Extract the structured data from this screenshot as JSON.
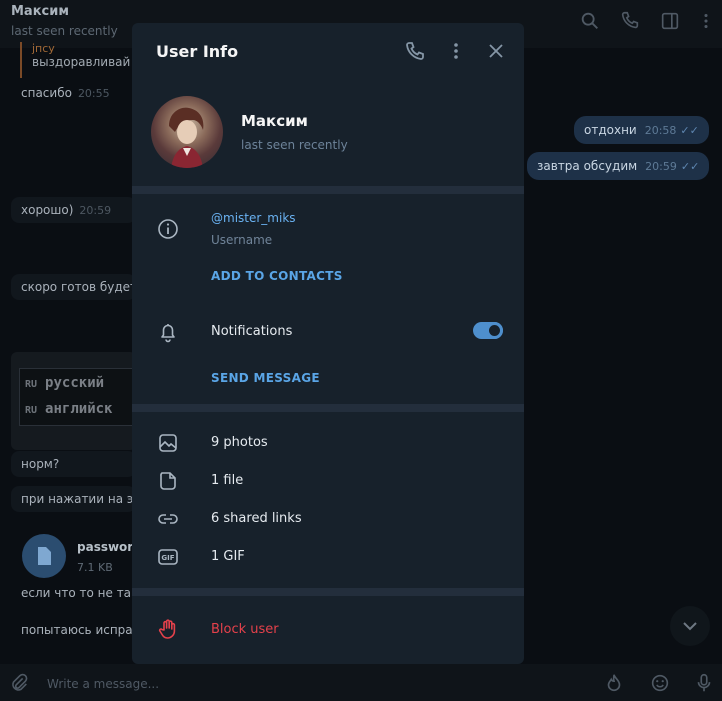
{
  "chat": {
    "title": "Максим",
    "status": "last seen recently",
    "reply": {
      "author": "јпсу",
      "text": "выздоравливай"
    },
    "incoming": [
      {
        "text": "спасибо",
        "time": "20:55"
      },
      {
        "text": "хорошо)",
        "time": "20:59"
      },
      {
        "text": "скоро готов будет",
        "time": ""
      },
      {
        "text": "норм?",
        "time": ""
      },
      {
        "text": "при нажатии на эт",
        "time": ""
      },
      {
        "text": "если что то не так",
        "time": ""
      },
      {
        "text": "попытаюсь испра",
        "time": ""
      }
    ],
    "outgoing": [
      {
        "text": "отдохни",
        "time": "20:58",
        "tick": "✓✓"
      },
      {
        "text": "завтра обсудим",
        "time": "20:59",
        "tick": "✓✓"
      }
    ],
    "lang_rows": [
      {
        "code": "RU",
        "name": "русский"
      },
      {
        "code": "RU",
        "name": "английск"
      }
    ],
    "file": {
      "name": "passwor",
      "size": "7.1 KB"
    },
    "composer_placeholder": "Write a message..."
  },
  "modal": {
    "title": "User Info",
    "user": {
      "name": "Максим",
      "status": "last seen recently"
    },
    "username": "@mister_miks",
    "username_label": "Username",
    "add_contacts": "ADD TO CONTACTS",
    "notifications_label": "Notifications",
    "notifications_on": true,
    "send_message": "SEND MESSAGE",
    "media": [
      {
        "icon": "photo-icon",
        "label": "9 photos"
      },
      {
        "icon": "file-icon",
        "label": "1 file"
      },
      {
        "icon": "link-icon",
        "label": "6 shared links"
      },
      {
        "icon": "gif-icon",
        "label": "1 GIF"
      }
    ],
    "block": "Block user"
  },
  "colors": {
    "modal_bg": "#17212b",
    "accent": "#5aa5e6",
    "danger": "#e5414b",
    "link": "#6ab2f2"
  }
}
